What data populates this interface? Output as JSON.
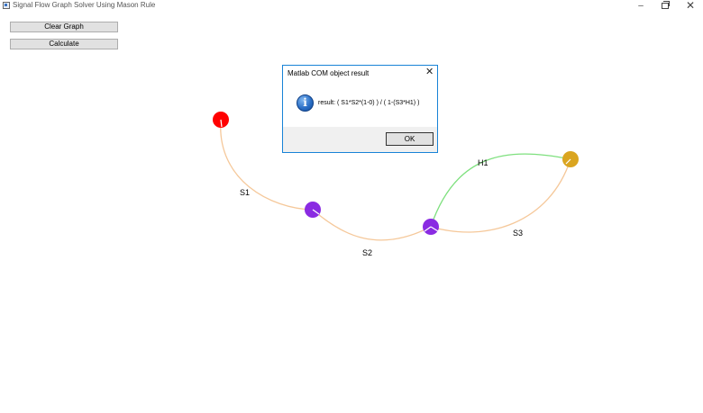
{
  "window": {
    "title": "Signal Flow Graph Solver Using Mason Rule",
    "minimize_glyph": "–",
    "close_glyph": "✕"
  },
  "toolbar": {
    "clear_label": "Clear Graph",
    "calculate_label": "Calculate"
  },
  "graph": {
    "nodes": [
      {
        "id": "n1",
        "color": "#ff0000"
      },
      {
        "id": "n2",
        "color": "#8a2be2"
      },
      {
        "id": "n3",
        "color": "#8a2be2"
      },
      {
        "id": "n4",
        "color": "#daa520"
      }
    ],
    "edges": [
      {
        "label": "S1",
        "from": "n1",
        "to": "n2",
        "color": "#f5c89a"
      },
      {
        "label": "S2",
        "from": "n2",
        "to": "n3",
        "color": "#f5c89a"
      },
      {
        "label": "S3",
        "from": "n3",
        "to": "n4",
        "color": "#f5c89a"
      },
      {
        "label": "H1",
        "from": "n4",
        "to": "n3",
        "color": "#7ee07e"
      }
    ]
  },
  "dialog": {
    "title": "Matlab COM object result",
    "close_glyph": "✕",
    "icon_glyph": "i",
    "message": "result: ( S1*S2*(1-0) ) / ( 1-(S3*H1) )",
    "ok_label": "OK"
  }
}
